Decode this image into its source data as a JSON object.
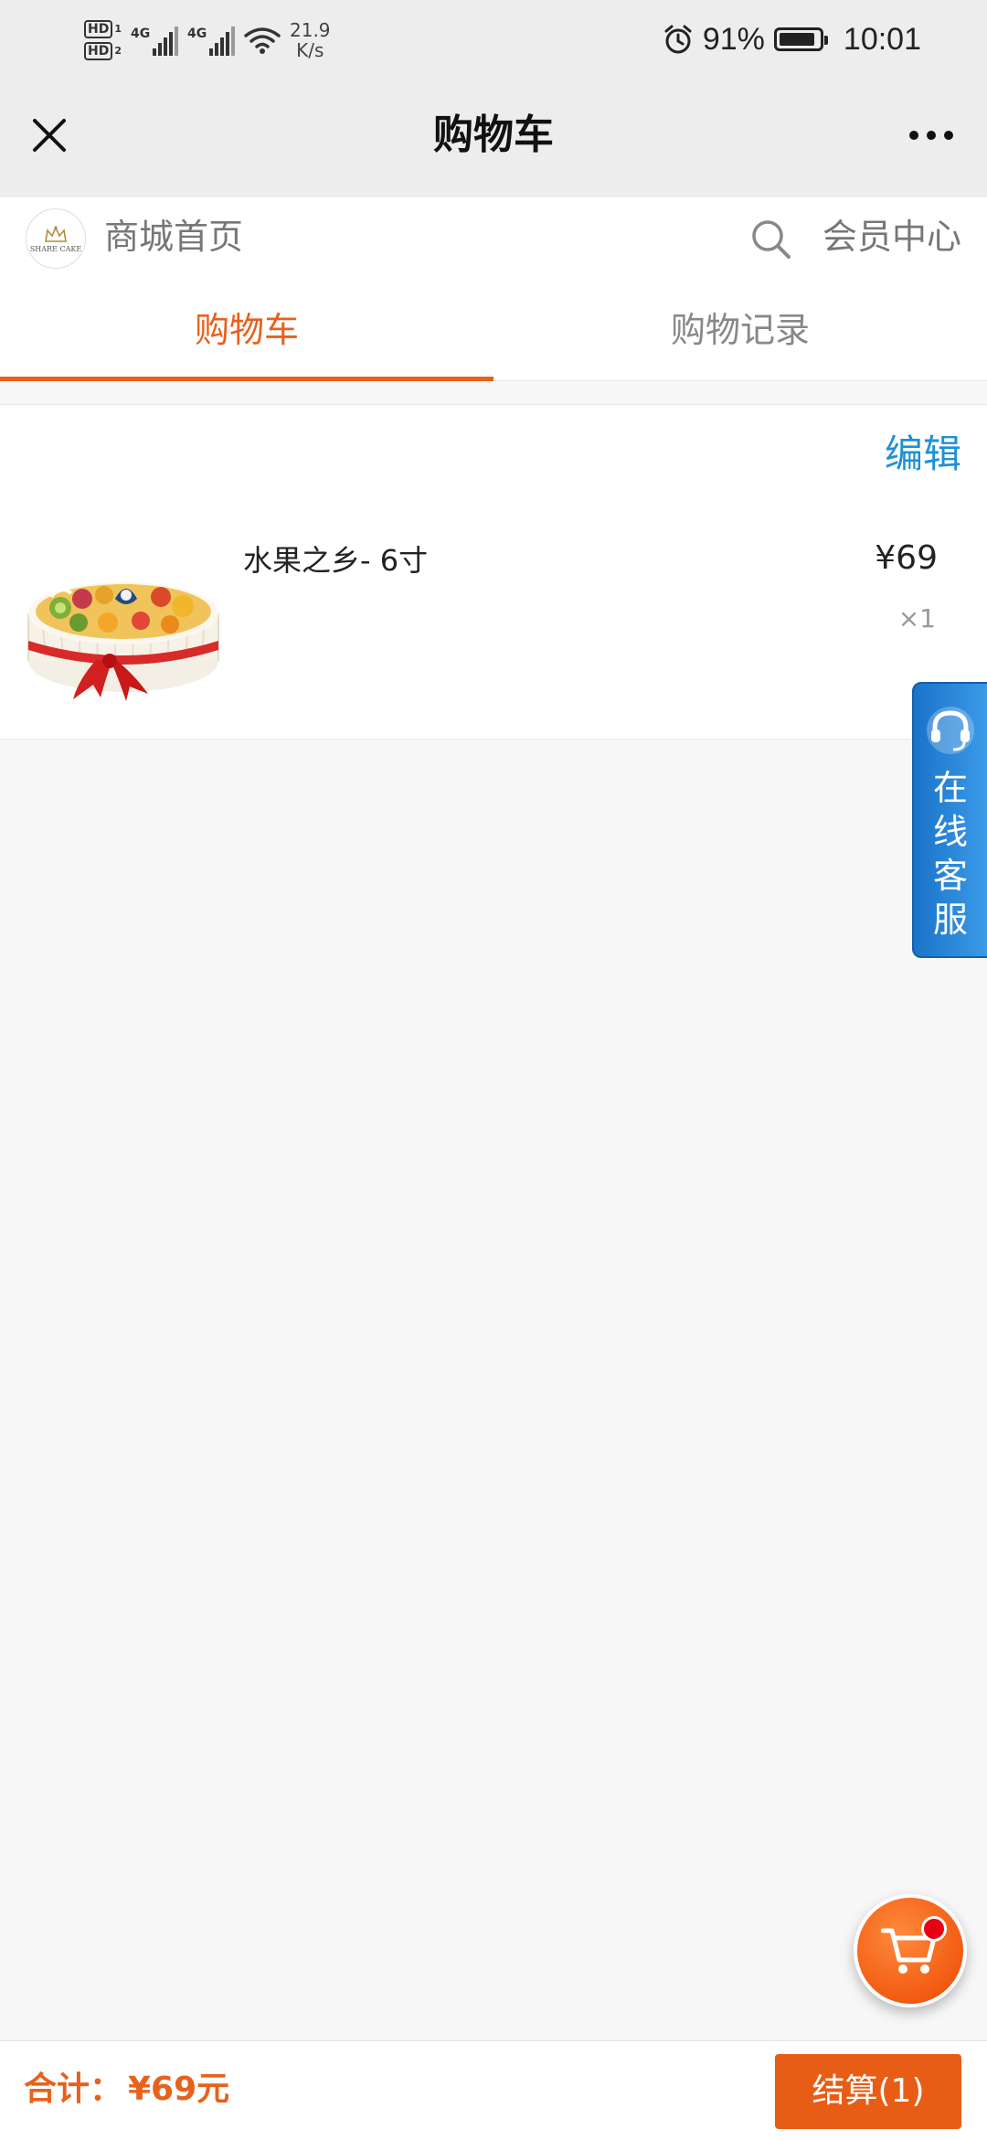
{
  "status_bar": {
    "hd1": "HD",
    "hd1_sub": "1",
    "hd2": "HD",
    "hd2_sub": "2",
    "network1": "4G",
    "network2": "4G",
    "speed_value": "21.9",
    "speed_unit": "K/s",
    "battery": "91%",
    "battery_level": 0.91,
    "time": "10:01",
    "icons": [
      "signal-icon",
      "wifi-icon",
      "alarm-icon",
      "battery-icon"
    ]
  },
  "title_bar": {
    "title": "购物车",
    "close_icon": "close-icon",
    "more_icon": "more-icon"
  },
  "shop_header": {
    "logo_text": "SHARE CAKE",
    "home_label": "商城首页",
    "search_icon": "search-icon",
    "member_label": "会员中心"
  },
  "tabs": [
    {
      "label": "购物车",
      "active": true
    },
    {
      "label": "购物记录",
      "active": false
    }
  ],
  "cart": {
    "edit_label": "编辑",
    "items": [
      {
        "name": "水果之乡- 6寸",
        "price": "¥69",
        "qty": "×1",
        "image": "fruit-cake-image"
      }
    ]
  },
  "service": {
    "label": "在线客服",
    "icon": "headset-icon"
  },
  "floating_cart": {
    "icon": "cart-icon"
  },
  "footer": {
    "total_label": "合计：",
    "total_value": "¥69元",
    "checkout_label": "结算(1)"
  },
  "colors": {
    "accent": "#e8611c",
    "link_blue": "#1e90d6",
    "service_blue": "#1a74c9",
    "checkout_bg": "#e85d16"
  }
}
